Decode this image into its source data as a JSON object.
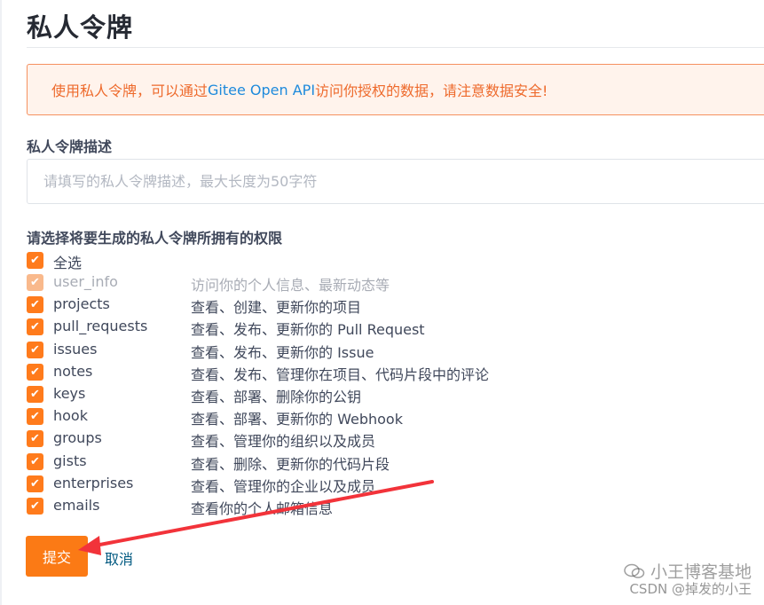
{
  "page": {
    "title": "私人令牌"
  },
  "notice": {
    "text_before": "使用私人令牌，可以通过 ",
    "brand": "Gitee Open API",
    "text_after": " 访问你授权的数据，请注意数据安全!"
  },
  "description": {
    "label": "私人令牌描述",
    "placeholder": "请填写的私人令牌描述，最大长度为50字符",
    "value": ""
  },
  "permissions": {
    "label": "请选择将要生成的私人令牌所拥有的权限",
    "select_all": {
      "label": "全选",
      "checked": true
    },
    "items": [
      {
        "name": "user_info",
        "desc": "访问你的个人信息、最新动态等",
        "checked": true,
        "disabled": true
      },
      {
        "name": "projects",
        "desc": "查看、创建、更新你的项目",
        "checked": true,
        "disabled": false
      },
      {
        "name": "pull_requests",
        "desc": "查看、发布、更新你的 Pull Request",
        "checked": true,
        "disabled": false
      },
      {
        "name": "issues",
        "desc": "查看、发布、更新你的 Issue",
        "checked": true,
        "disabled": false
      },
      {
        "name": "notes",
        "desc": "查看、发布、管理你在项目、代码片段中的评论",
        "checked": true,
        "disabled": false
      },
      {
        "name": "keys",
        "desc": "查看、部署、删除你的公钥",
        "checked": true,
        "disabled": false
      },
      {
        "name": "hook",
        "desc": "查看、部署、更新你的 Webhook",
        "checked": true,
        "disabled": false
      },
      {
        "name": "groups",
        "desc": "查看、管理你的组织以及成员",
        "checked": true,
        "disabled": false
      },
      {
        "name": "gists",
        "desc": "查看、删除、更新你的代码片段",
        "checked": true,
        "disabled": false
      },
      {
        "name": "enterprises",
        "desc": "查看、管理你的企业以及成员",
        "checked": true,
        "disabled": false
      },
      {
        "name": "emails",
        "desc": "查看你的个人邮箱信息",
        "checked": true,
        "disabled": false
      }
    ]
  },
  "actions": {
    "submit_label": "提交",
    "cancel_label": "取消"
  },
  "watermark": {
    "line1": "小王博客基地",
    "line2": "CSDN @掉发的小王"
  },
  "colors": {
    "accent": "#fb7a15",
    "checkbox": "#ff7b1c",
    "notice_text": "#ee6a2c",
    "brand_text": "#1e8adc",
    "annotation_arrow": "#f2333a"
  },
  "icons": {
    "checkbox": "check-icon",
    "watermark": "wechat-icon"
  }
}
